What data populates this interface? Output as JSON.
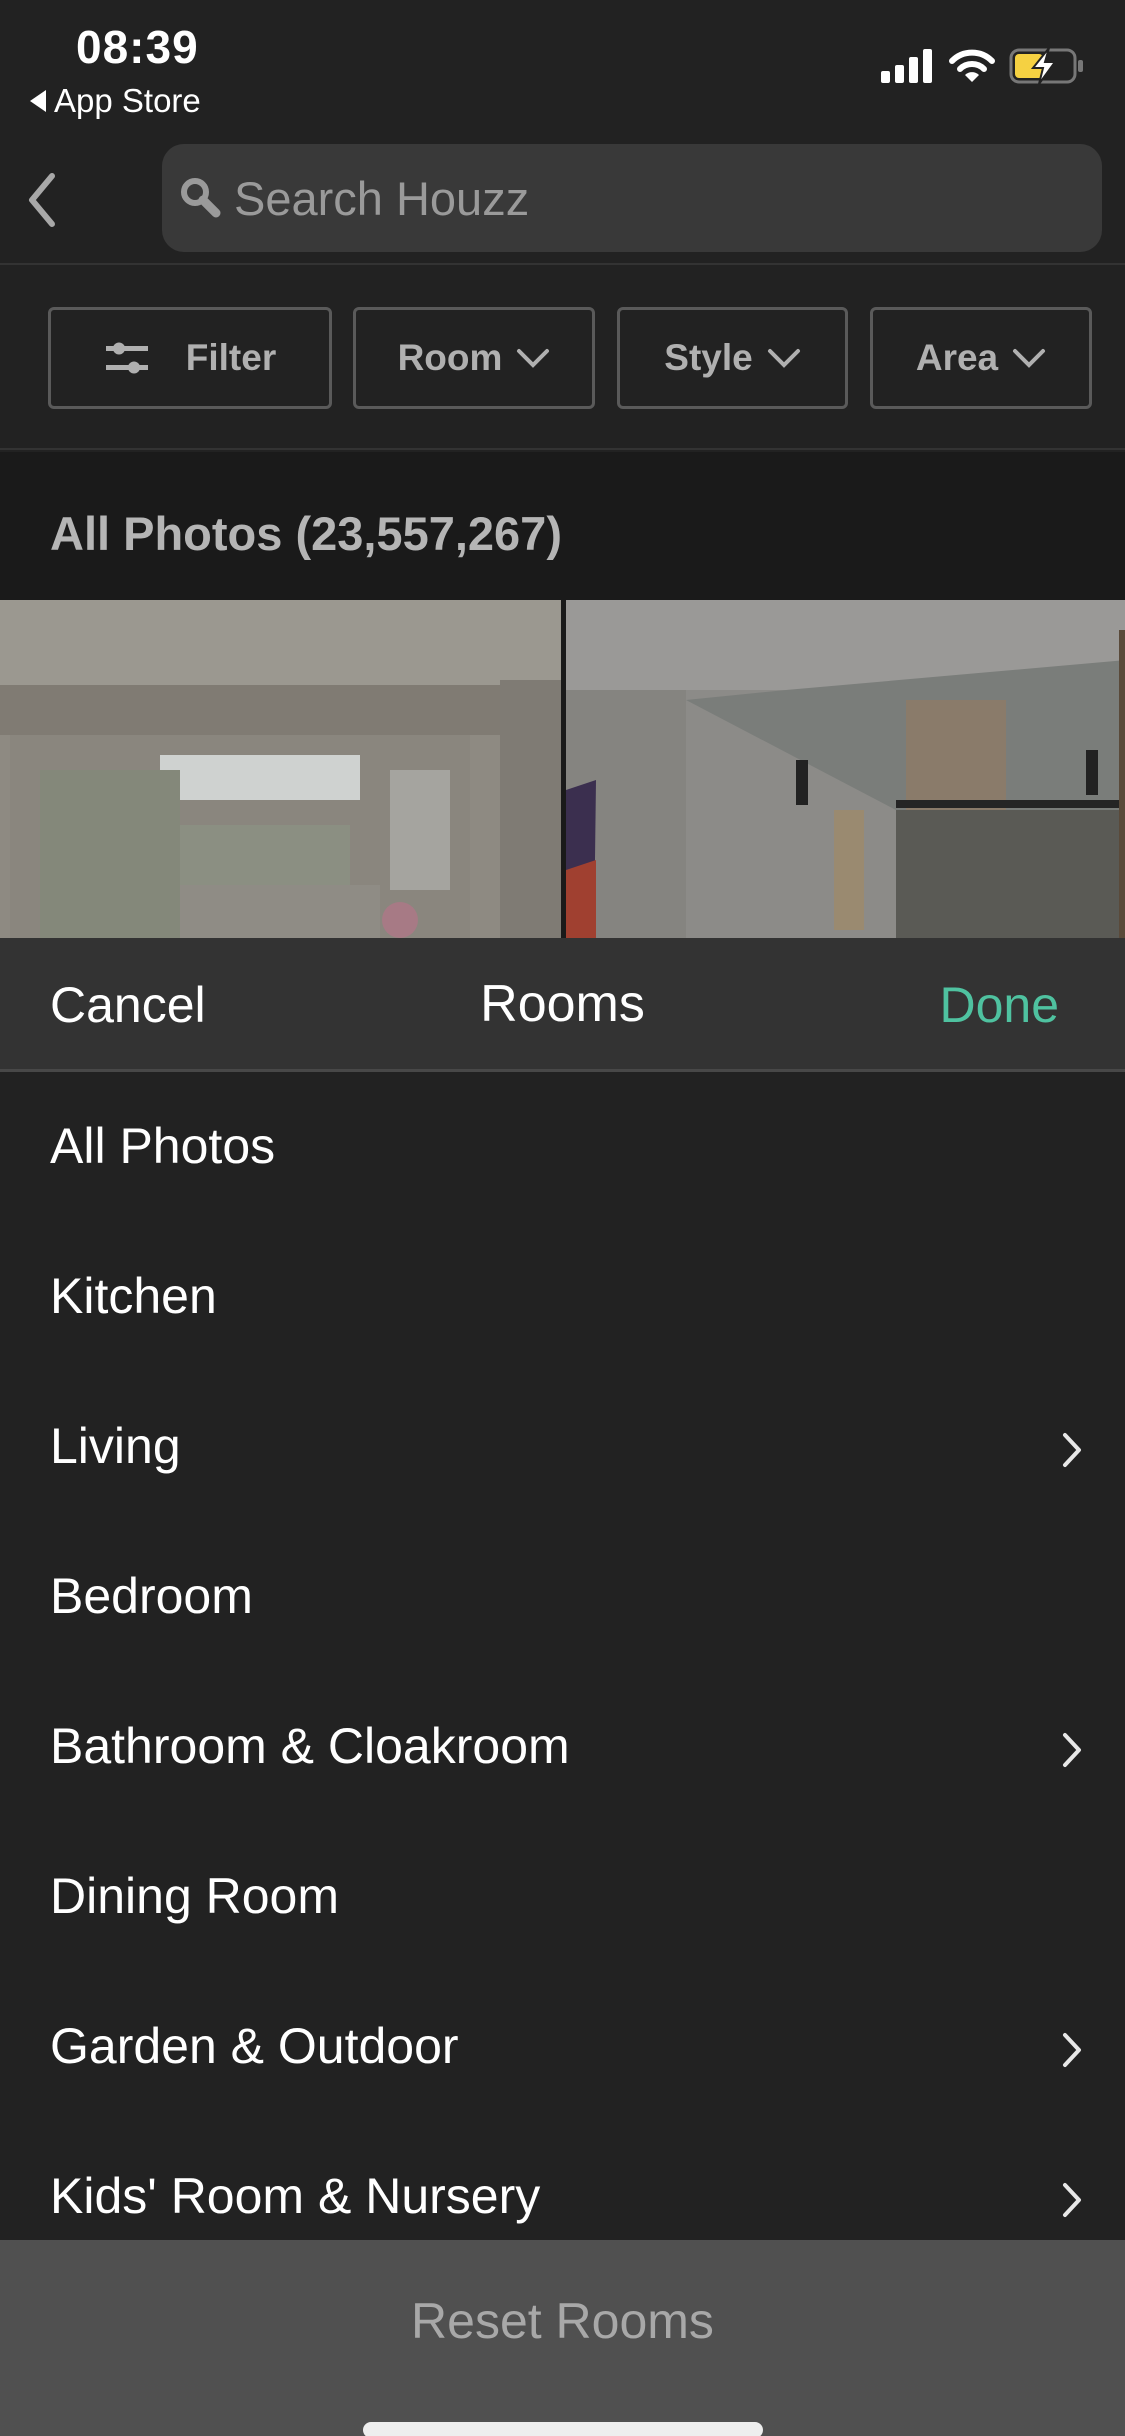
{
  "status_bar": {
    "time": "08:39",
    "back_app_label": "App Store",
    "icons": [
      "cellular-signal-icon",
      "wifi-icon",
      "battery-charging-icon"
    ],
    "battery_color": "#f5d142"
  },
  "nav": {
    "back_icon": "chevron-left-icon",
    "search_placeholder": "Search Houzz"
  },
  "filters": {
    "filter_label": "Filter",
    "room_label": "Room",
    "style_label": "Style",
    "area_label": "Area"
  },
  "photos_header": {
    "title": "All Photos (23,557,267)"
  },
  "sheet": {
    "cancel_label": "Cancel",
    "title": "Rooms",
    "done_label": "Done",
    "done_color": "#4fc2a0"
  },
  "rooms": [
    {
      "label": "All Photos",
      "has_children": false
    },
    {
      "label": "Kitchen",
      "has_children": false
    },
    {
      "label": "Living",
      "has_children": true
    },
    {
      "label": "Bedroom",
      "has_children": false
    },
    {
      "label": "Bathroom & Cloakroom",
      "has_children": true
    },
    {
      "label": "Dining Room",
      "has_children": false
    },
    {
      "label": "Garden & Outdoor",
      "has_children": true
    },
    {
      "label": "Kids' Room & Nursery",
      "has_children": true
    }
  ],
  "reset": {
    "label": "Reset Rooms"
  }
}
